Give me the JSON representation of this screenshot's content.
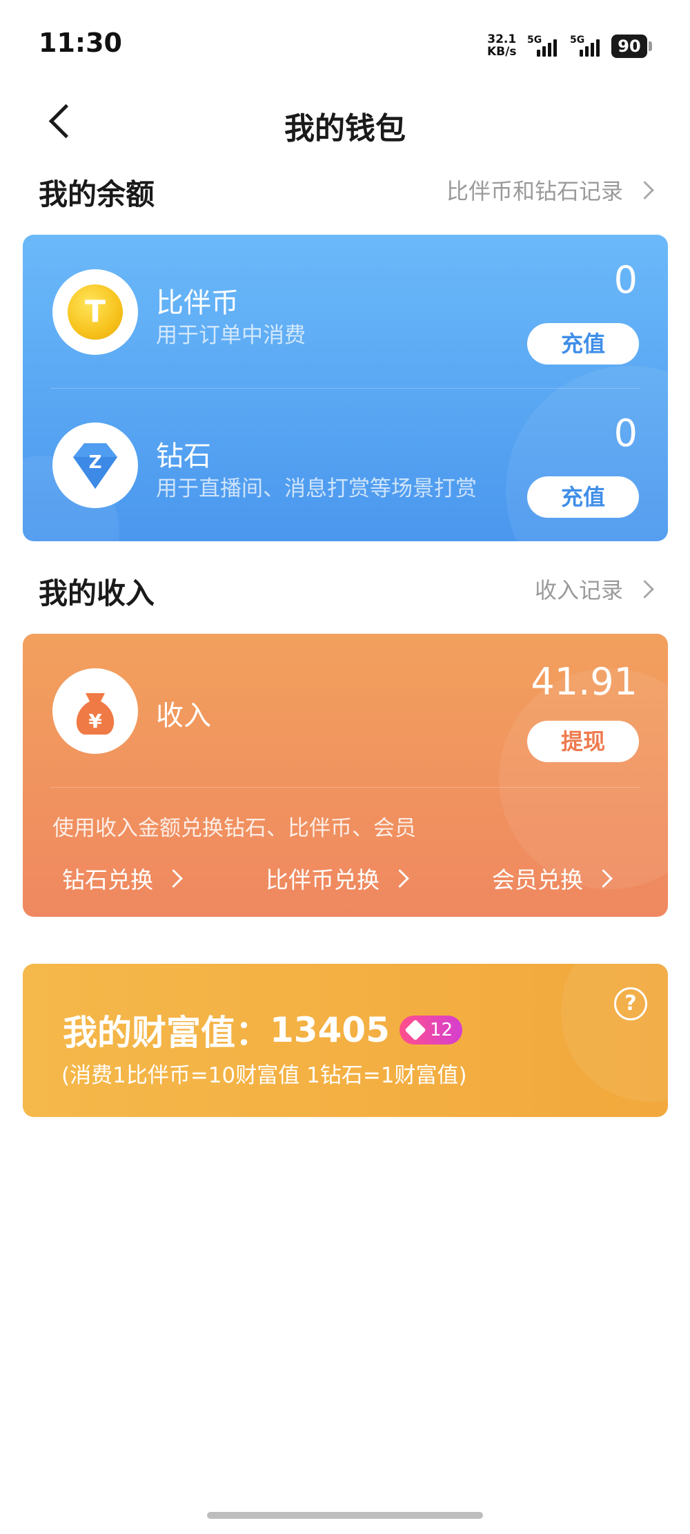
{
  "status_bar": {
    "time": "11:30",
    "net_speed_value": "32.1",
    "net_speed_unit": "KB/s",
    "signal_1": "5G",
    "signal_2": "5G",
    "battery": "90"
  },
  "header": {
    "title": "我的钱包"
  },
  "balance": {
    "section_title": "我的余额",
    "records_link": "比伴币和钻石记录",
    "coin": {
      "title": "比伴币",
      "subtitle": "用于订单中消费",
      "amount": "0",
      "button": "充值",
      "icon_glyph": "T"
    },
    "diamond": {
      "title": "钻石",
      "subtitle": "用于直播间、消息打赏等场景打赏",
      "amount": "0",
      "button": "充值",
      "icon_glyph": "Z"
    }
  },
  "income": {
    "section_title": "我的收入",
    "records_link": "收入记录",
    "title": "收入",
    "amount": "41.91",
    "button": "提现",
    "icon_glyph": "¥",
    "note": "使用收入金额兑换钻石、比伴币、会员",
    "exchange": {
      "diamond": "钻石兑换",
      "coin": "比伴币兑换",
      "vip": "会员兑换"
    }
  },
  "wealth": {
    "label": "我的财富值：",
    "value": "13405",
    "level": "12",
    "rule": "(消费1比伴币=10财富值 1钻石=1财富值)"
  },
  "colors": {
    "blue_card": "#4a97ee",
    "orange_card": "#ef8860",
    "yellow_card": "#f2a83c",
    "pill_text_blue": "#3f8ee8",
    "pill_text_orange": "#ee7a4e"
  }
}
